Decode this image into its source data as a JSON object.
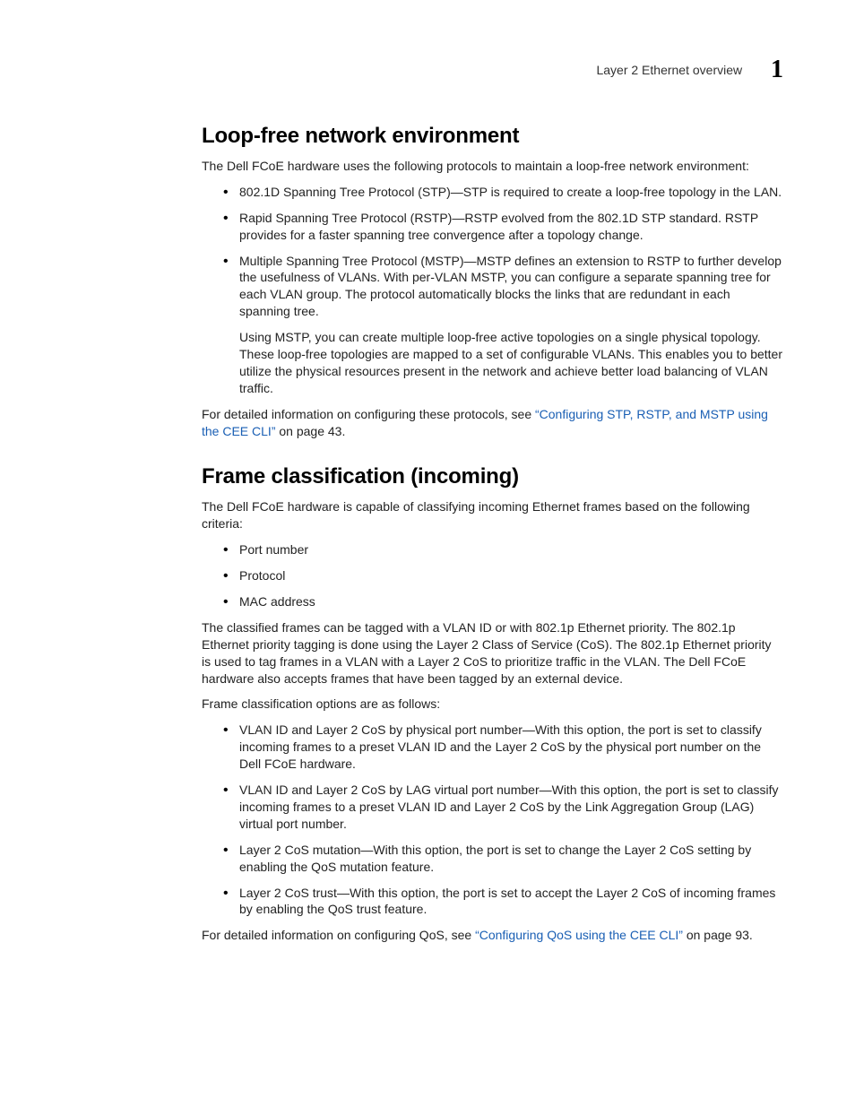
{
  "header": {
    "chapter_title": "Layer 2 Ethernet overview",
    "chapter_number": "1"
  },
  "section1": {
    "heading": "Loop-free network environment",
    "intro": "The Dell FCoE hardware uses the following protocols to maintain a loop-free network environment:",
    "bullets": [
      {
        "text": "802.1D Spanning Tree Protocol (STP)—STP is required to create a loop-free topology in the LAN."
      },
      {
        "text": "Rapid Spanning Tree Protocol (RSTP)—RSTP evolved from the 802.1D STP standard. RSTP provides for a faster spanning tree convergence after a topology change."
      },
      {
        "text": "Multiple Spanning Tree Protocol (MSTP)—MSTP defines an extension to RSTP to further develop the usefulness of VLANs. With per-VLAN MSTP, you can configure a separate spanning tree for each VLAN group. The protocol automatically blocks the links that are redundant in each spanning tree.",
        "sub": "Using MSTP, you can create multiple loop-free active topologies on a single physical topology. These loop-free topologies are mapped to a set of configurable VLANs. This enables you to better utilize the physical resources present in the network and achieve better load balancing of VLAN traffic."
      }
    ],
    "outro_pre": "For detailed information on configuring these protocols, see ",
    "outro_link": "“Configuring STP, RSTP, and MSTP using the CEE CLI”",
    "outro_post": " on page 43."
  },
  "section2": {
    "heading": "Frame classification (incoming)",
    "intro": "The Dell FCoE hardware is capable of classifying incoming Ethernet frames based on the following criteria:",
    "criteria": [
      "Port number",
      "Protocol",
      "MAC address"
    ],
    "para_tagging": "The classified frames can be tagged with a VLAN ID or with 802.1p Ethernet priority. The 802.1p Ethernet priority tagging is done using the Layer 2 Class of Service (CoS). The 802.1p Ethernet priority is used to tag frames in a VLAN with a Layer 2 CoS to prioritize traffic in the VLAN. The Dell FCoE hardware also accepts frames that have been tagged by an external device.",
    "para_options_lead": "Frame classification options are as follows:",
    "options": [
      "VLAN ID and Layer 2 CoS by physical port number—With this option, the port is set to classify incoming frames to a preset VLAN ID and the Layer 2 CoS by the physical port number on the Dell FCoE hardware.",
      "VLAN ID and Layer 2 CoS by LAG virtual port number—With this option, the port is set to classify incoming frames to a preset VLAN ID and Layer 2 CoS by the Link Aggregation Group (LAG) virtual port number.",
      "Layer 2 CoS mutation—With this option, the port is set to change the Layer 2 CoS setting by enabling the QoS mutation feature.",
      "Layer 2 CoS trust—With this option, the port is set to accept the Layer 2 CoS of incoming frames by enabling the QoS trust feature."
    ],
    "outro_pre": "For detailed information on configuring QoS, see ",
    "outro_link": "“Configuring QoS using the CEE CLI”",
    "outro_post": " on page 93."
  }
}
